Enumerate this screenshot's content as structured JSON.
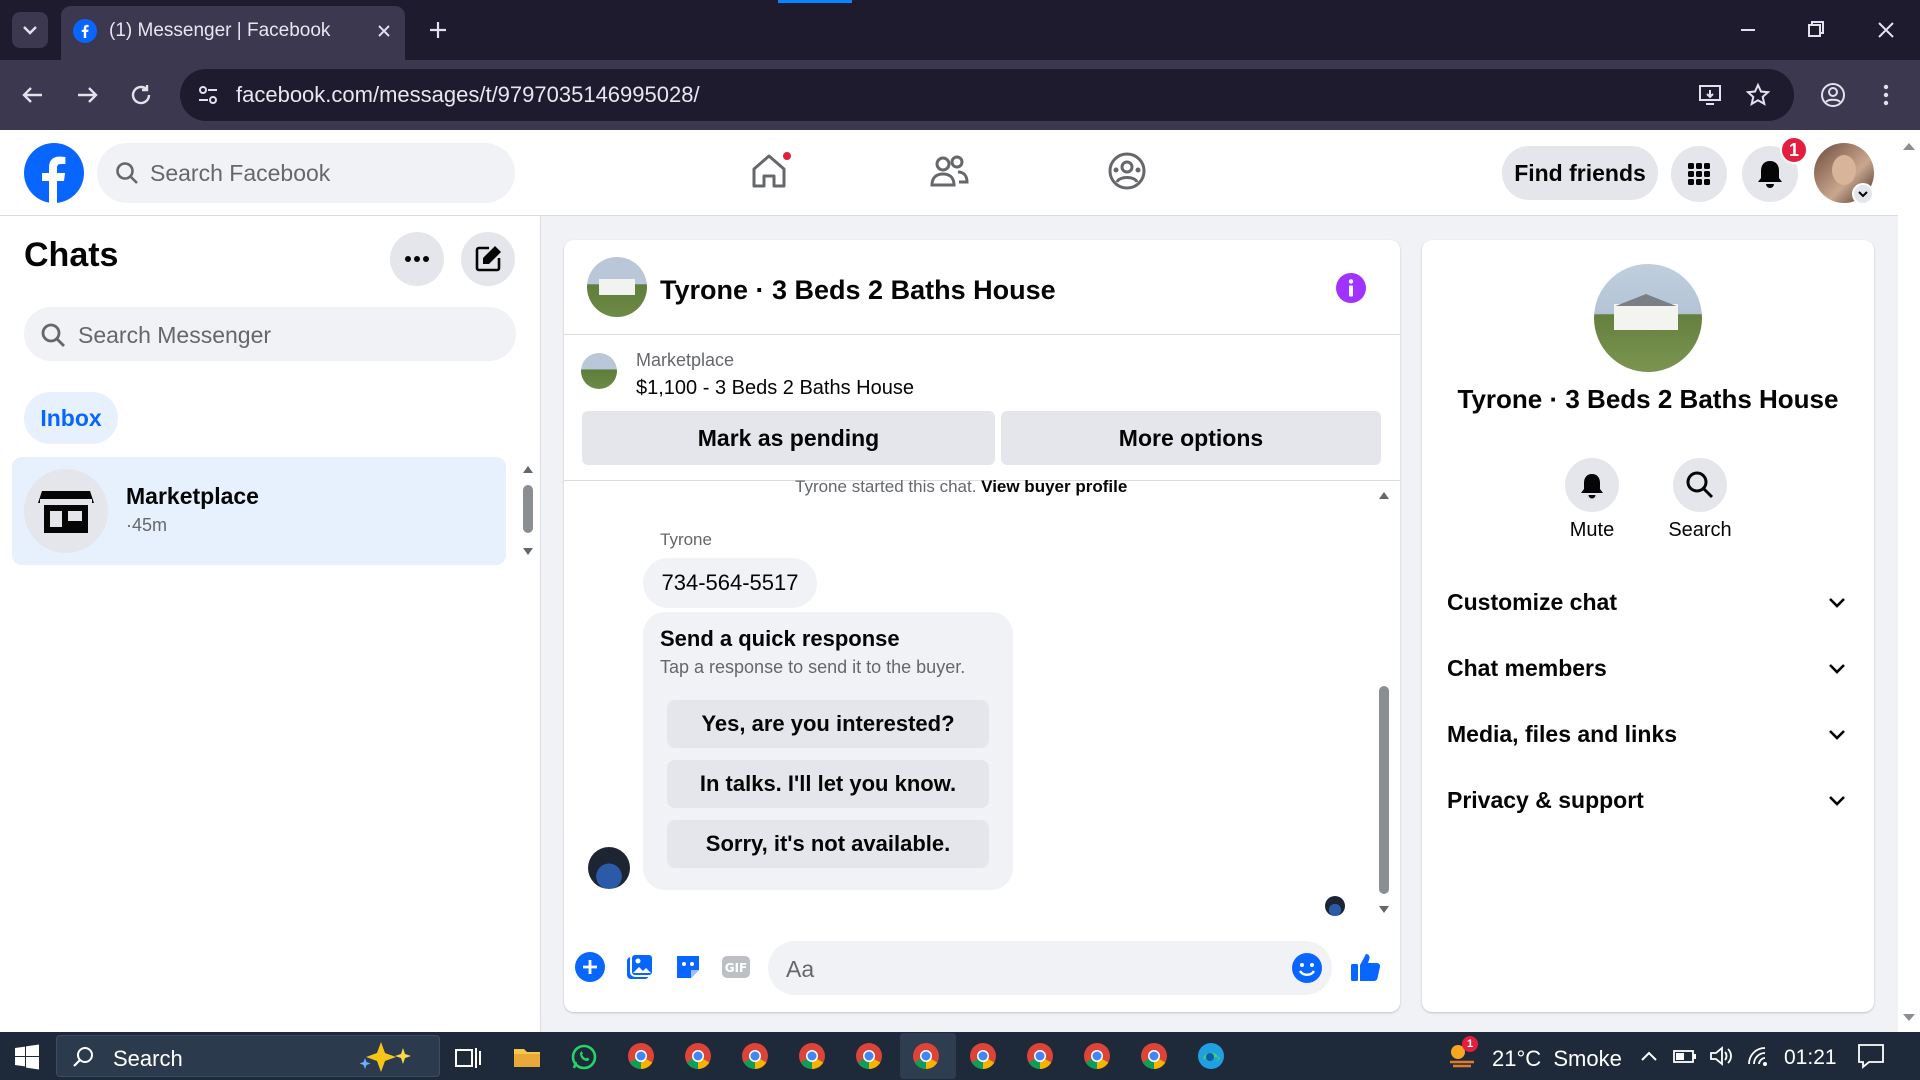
{
  "browser": {
    "tab_title": "(1) Messenger | Facebook",
    "url": "facebook.com/messages/t/9797035146995028/"
  },
  "fb_header": {
    "search_placeholder": "Search Facebook",
    "find_friends_label": "Find friends",
    "notification_count": "1"
  },
  "left": {
    "title": "Chats",
    "search_placeholder": "Search Messenger",
    "inbox_label": "Inbox",
    "chat_items": [
      {
        "name": "Marketplace",
        "time": "·45m"
      }
    ]
  },
  "conversation": {
    "title": "Tyrone · 3 Beds 2 Baths House",
    "listing_category": "Marketplace",
    "listing_text": "$1,100 - 3 Beds 2 Baths House",
    "mark_pending_label": "Mark as pending",
    "more_options_label": "More options",
    "started_text": "Tyrone started this chat.",
    "buyer_profile_link": "View buyer profile",
    "sender_name": "Tyrone",
    "message": "734-564-5517",
    "quick_title": "Send a quick response",
    "quick_subtitle": "Tap a response to send it to the buyer.",
    "quick_responses": [
      "Yes, are you interested?",
      "In talks. I'll let you know.",
      "Sorry, it's not available."
    ],
    "composer_placeholder": "Aa"
  },
  "right": {
    "title": "Tyrone · 3 Beds 2 Baths House",
    "mute_label": "Mute",
    "search_label": "Search",
    "sections": [
      "Customize chat",
      "Chat members",
      "Media, files and links",
      "Privacy & support"
    ]
  },
  "taskbar": {
    "search_label": "Search",
    "weather": "21°C  Smoke",
    "time": "01:21",
    "weather_badge": "1"
  },
  "colors": {
    "fb_blue": "#0866ff",
    "messenger_accent": "#a033ff",
    "badge_red": "#e41e3f"
  }
}
